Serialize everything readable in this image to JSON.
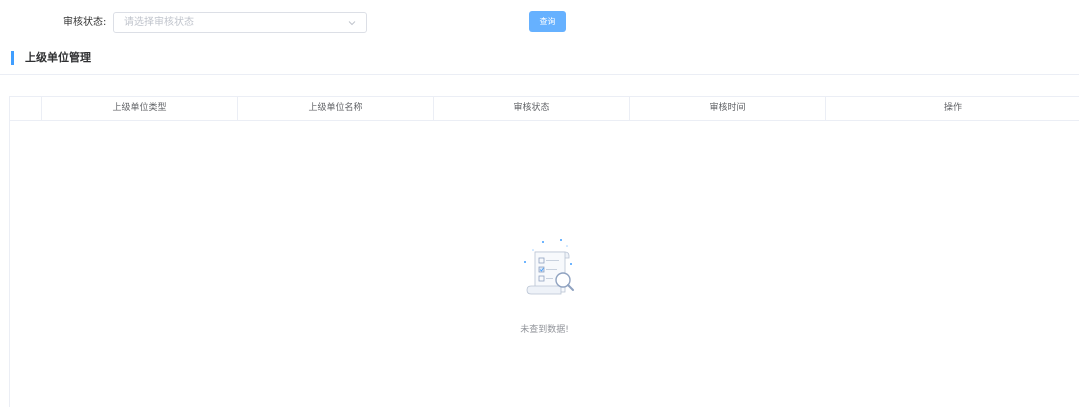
{
  "filter": {
    "label": "审核状态:",
    "placeholder": "请选择审核状态",
    "search_button": "查询"
  },
  "section": {
    "title": "上级单位管理"
  },
  "table": {
    "columns": [
      "",
      "上级单位类型",
      "上级单位名称",
      "审核状态",
      "审核时间",
      "操作"
    ],
    "rows": [],
    "empty_text": "未查到数据!"
  },
  "colors": {
    "accent": "#409eff",
    "button": "#66b1ff",
    "border": "#ebeef5"
  },
  "icons": {
    "select_arrow": "chevron-down-icon",
    "empty": "empty-document-search-icon"
  }
}
